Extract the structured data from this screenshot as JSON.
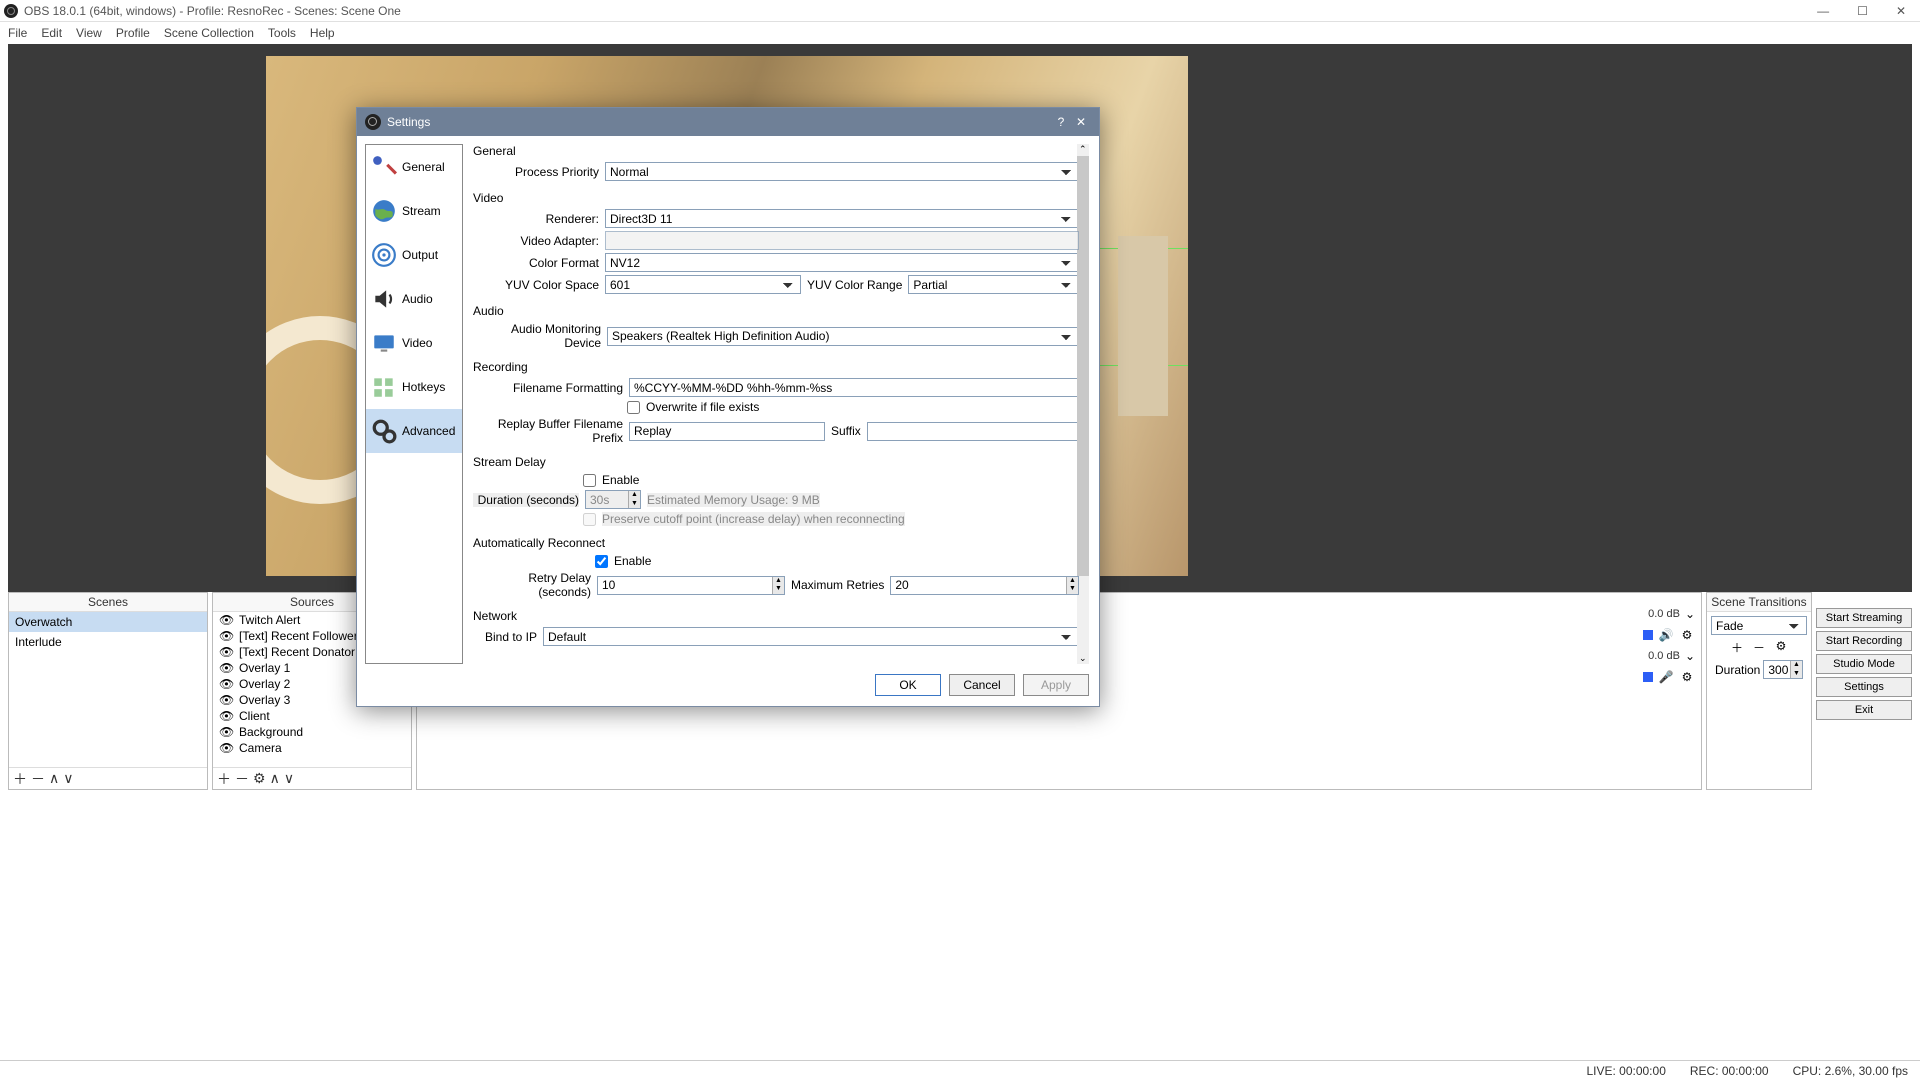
{
  "window": {
    "title": "OBS 18.0.1 (64bit, windows) - Profile: ResnoRec - Scenes: Scene One"
  },
  "menubar": [
    "File",
    "Edit",
    "View",
    "Profile",
    "Scene Collection",
    "Tools",
    "Help"
  ],
  "panels": {
    "scenes_header": "Scenes",
    "sources_header": "Sources",
    "transitions_header": "Scene Transitions"
  },
  "scenes": [
    {
      "name": "Overwatch",
      "selected": true
    },
    {
      "name": "Interlude",
      "selected": false
    }
  ],
  "sources": [
    "Twitch Alert",
    "[Text] Recent Follower",
    "[Text] Recent Donator",
    "Overlay 1",
    "Overlay 2",
    "Overlay 3",
    "Client",
    "Background",
    "Camera"
  ],
  "mixer": {
    "db1": "0.0 dB",
    "db2": "0.0 dB"
  },
  "transitions": {
    "selected": "Fade",
    "duration_label": "Duration",
    "duration_value": "300ms"
  },
  "controls": {
    "start_streaming": "Start Streaming",
    "start_recording": "Start Recording",
    "studio_mode": "Studio Mode",
    "settings": "Settings",
    "exit": "Exit"
  },
  "status": {
    "live": "LIVE: 00:00:00",
    "rec": "REC: 00:00:00",
    "cpu": "CPU: 2.6%, 30.00 fps"
  },
  "dialog": {
    "title": "Settings",
    "sidebar": [
      "General",
      "Stream",
      "Output",
      "Audio",
      "Video",
      "Hotkeys",
      "Advanced"
    ],
    "sections": {
      "general": "General",
      "process_priority_label": "Process Priority",
      "process_priority_value": "Normal",
      "video": "Video",
      "renderer_label": "Renderer:",
      "renderer_value": "Direct3D 11",
      "video_adapter_label": "Video Adapter:",
      "video_adapter_value": "",
      "color_format_label": "Color Format",
      "color_format_value": "NV12",
      "yuv_space_label": "YUV Color Space",
      "yuv_space_value": "601",
      "yuv_range_label": "YUV Color Range",
      "yuv_range_value": "Partial",
      "audio": "Audio",
      "audio_mon_label": "Audio Monitoring Device",
      "audio_mon_value": "Speakers (Realtek High Definition Audio)",
      "recording": "Recording",
      "filename_fmt_label": "Filename Formatting",
      "filename_fmt_value": "%CCYY-%MM-%DD %hh-%mm-%ss",
      "overwrite_label": "Overwrite if file exists",
      "replay_prefix_label": "Replay Buffer Filename Prefix",
      "replay_prefix_value": "Replay",
      "suffix_label": "Suffix",
      "suffix_value": "",
      "stream_delay": "Stream Delay",
      "enable_label": "Enable",
      "duration_sec_label": "Duration (seconds)",
      "duration_sec_value": "30s",
      "est_mem": "Estimated Memory Usage: 9 MB",
      "preserve_label": "Preserve cutoff point (increase delay) when reconnecting",
      "auto_reconnect": "Automatically Reconnect",
      "retry_delay_label": "Retry Delay (seconds)",
      "retry_delay_value": "10",
      "max_retries_label": "Maximum Retries",
      "max_retries_value": "20",
      "network": "Network",
      "bind_ip_label": "Bind to IP",
      "bind_ip_value": "Default"
    },
    "buttons": {
      "ok": "OK",
      "cancel": "Cancel",
      "apply": "Apply"
    }
  }
}
